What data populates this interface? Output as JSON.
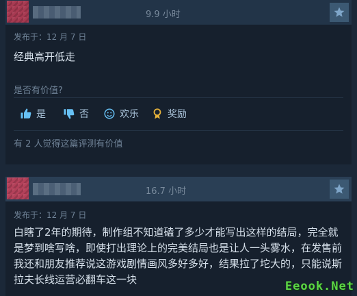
{
  "reviews": [
    {
      "hours": "9.9 小时",
      "posted": "发布于：12 月 7 日",
      "text": "经典高开低走",
      "helpful_question": "是否有价值?",
      "votes": {
        "yes": "是",
        "no": "否",
        "funny": "欢乐",
        "award": "奖励"
      },
      "found_helpful": "有 2 人觉得这篇评测有价值"
    },
    {
      "hours": "16.7 小时",
      "posted": "发布于：12 月 7 日",
      "text": "白瞎了2年的期待，制作组不知道磕了多少才能写出这样的结局，完全就是梦到啥写啥，即使打出理论上的完美结局也是让人一头雾水，在发售前我还和朋友推荐说这游戏剧情画风多好多好，结果拉了坨大的，只能说斯拉夫长线运营必翻车这一块"
    }
  ],
  "watermark": "Eeook.Net"
}
